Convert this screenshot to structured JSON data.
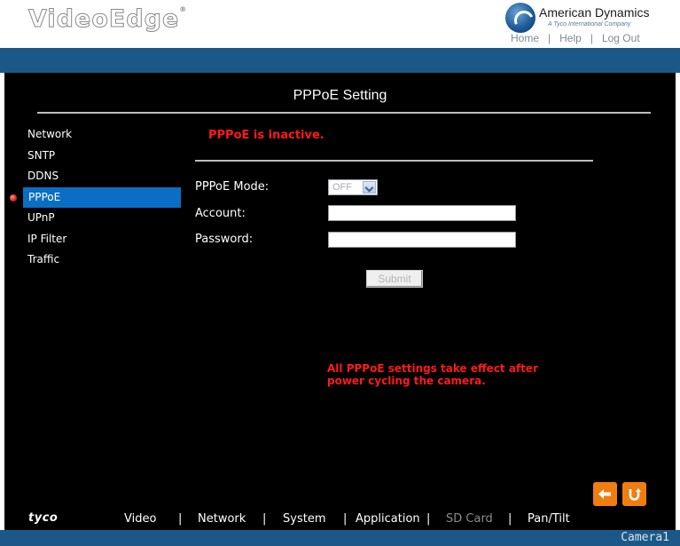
{
  "header": {
    "brand": "VideoEdge",
    "registered": "®",
    "company_name": "American Dynamics",
    "company_tagline": "A Tyco International Company",
    "links": [
      "Home",
      "Help",
      "Log Out"
    ],
    "link_separator": "|"
  },
  "page": {
    "title": "PPPoE Setting",
    "status_message": "PPPoE is inactive.",
    "note": "All PPPoE settings take effect after power cycling the camera."
  },
  "sidebar": {
    "items": [
      {
        "label": "Network",
        "active": false
      },
      {
        "label": "SNTP",
        "active": false
      },
      {
        "label": "DDNS",
        "active": false
      },
      {
        "label": "PPPoE",
        "active": true
      },
      {
        "label": "UPnP",
        "active": false
      },
      {
        "label": "IP Filter",
        "active": false
      },
      {
        "label": "Traffic",
        "active": false
      }
    ]
  },
  "form": {
    "mode_label": "PPPoE Mode:",
    "mode_value": "OFF",
    "account_label": "Account:",
    "account_value": "",
    "password_label": "Password:",
    "password_value": "",
    "submit_label": "Submit"
  },
  "icons": {
    "back": "arrow-left-icon",
    "refresh": "refresh-icon"
  },
  "footer": {
    "brand": "tyco",
    "nav": [
      {
        "label": "Video",
        "dim": false
      },
      {
        "label": "Network",
        "dim": false
      },
      {
        "label": "System",
        "dim": false
      },
      {
        "label": "Application",
        "dim": false
      },
      {
        "label": "SD Card",
        "dim": true
      },
      {
        "label": "Pan/Tilt",
        "dim": false
      }
    ],
    "separator": "|",
    "camera_name": "Camera1"
  },
  "colors": {
    "band_blue": "#1c5887",
    "active_blue": "#0a6fc4",
    "alert_red": "#ff1a1a",
    "accent_orange": "#f07d10"
  }
}
